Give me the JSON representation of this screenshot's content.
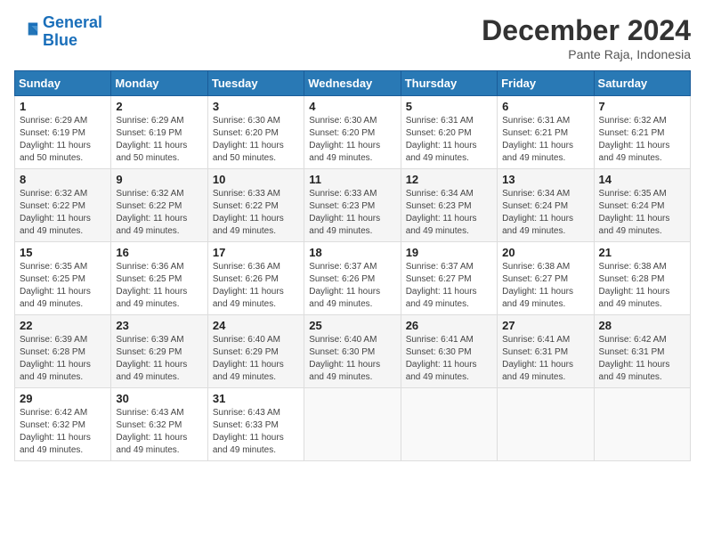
{
  "logo": {
    "line1": "General",
    "line2": "Blue"
  },
  "title": "December 2024",
  "subtitle": "Pante Raja, Indonesia",
  "weekdays": [
    "Sunday",
    "Monday",
    "Tuesday",
    "Wednesday",
    "Thursday",
    "Friday",
    "Saturday"
  ],
  "weeks": [
    [
      {
        "day": 1,
        "sunrise": "6:29 AM",
        "sunset": "6:19 PM",
        "daylight": "11 hours and 50 minutes."
      },
      {
        "day": 2,
        "sunrise": "6:29 AM",
        "sunset": "6:19 PM",
        "daylight": "11 hours and 50 minutes."
      },
      {
        "day": 3,
        "sunrise": "6:30 AM",
        "sunset": "6:20 PM",
        "daylight": "11 hours and 50 minutes."
      },
      {
        "day": 4,
        "sunrise": "6:30 AM",
        "sunset": "6:20 PM",
        "daylight": "11 hours and 49 minutes."
      },
      {
        "day": 5,
        "sunrise": "6:31 AM",
        "sunset": "6:20 PM",
        "daylight": "11 hours and 49 minutes."
      },
      {
        "day": 6,
        "sunrise": "6:31 AM",
        "sunset": "6:21 PM",
        "daylight": "11 hours and 49 minutes."
      },
      {
        "day": 7,
        "sunrise": "6:32 AM",
        "sunset": "6:21 PM",
        "daylight": "11 hours and 49 minutes."
      }
    ],
    [
      {
        "day": 8,
        "sunrise": "6:32 AM",
        "sunset": "6:22 PM",
        "daylight": "11 hours and 49 minutes."
      },
      {
        "day": 9,
        "sunrise": "6:32 AM",
        "sunset": "6:22 PM",
        "daylight": "11 hours and 49 minutes."
      },
      {
        "day": 10,
        "sunrise": "6:33 AM",
        "sunset": "6:22 PM",
        "daylight": "11 hours and 49 minutes."
      },
      {
        "day": 11,
        "sunrise": "6:33 AM",
        "sunset": "6:23 PM",
        "daylight": "11 hours and 49 minutes."
      },
      {
        "day": 12,
        "sunrise": "6:34 AM",
        "sunset": "6:23 PM",
        "daylight": "11 hours and 49 minutes."
      },
      {
        "day": 13,
        "sunrise": "6:34 AM",
        "sunset": "6:24 PM",
        "daylight": "11 hours and 49 minutes."
      },
      {
        "day": 14,
        "sunrise": "6:35 AM",
        "sunset": "6:24 PM",
        "daylight": "11 hours and 49 minutes."
      }
    ],
    [
      {
        "day": 15,
        "sunrise": "6:35 AM",
        "sunset": "6:25 PM",
        "daylight": "11 hours and 49 minutes."
      },
      {
        "day": 16,
        "sunrise": "6:36 AM",
        "sunset": "6:25 PM",
        "daylight": "11 hours and 49 minutes."
      },
      {
        "day": 17,
        "sunrise": "6:36 AM",
        "sunset": "6:26 PM",
        "daylight": "11 hours and 49 minutes."
      },
      {
        "day": 18,
        "sunrise": "6:37 AM",
        "sunset": "6:26 PM",
        "daylight": "11 hours and 49 minutes."
      },
      {
        "day": 19,
        "sunrise": "6:37 AM",
        "sunset": "6:27 PM",
        "daylight": "11 hours and 49 minutes."
      },
      {
        "day": 20,
        "sunrise": "6:38 AM",
        "sunset": "6:27 PM",
        "daylight": "11 hours and 49 minutes."
      },
      {
        "day": 21,
        "sunrise": "6:38 AM",
        "sunset": "6:28 PM",
        "daylight": "11 hours and 49 minutes."
      }
    ],
    [
      {
        "day": 22,
        "sunrise": "6:39 AM",
        "sunset": "6:28 PM",
        "daylight": "11 hours and 49 minutes."
      },
      {
        "day": 23,
        "sunrise": "6:39 AM",
        "sunset": "6:29 PM",
        "daylight": "11 hours and 49 minutes."
      },
      {
        "day": 24,
        "sunrise": "6:40 AM",
        "sunset": "6:29 PM",
        "daylight": "11 hours and 49 minutes."
      },
      {
        "day": 25,
        "sunrise": "6:40 AM",
        "sunset": "6:30 PM",
        "daylight": "11 hours and 49 minutes."
      },
      {
        "day": 26,
        "sunrise": "6:41 AM",
        "sunset": "6:30 PM",
        "daylight": "11 hours and 49 minutes."
      },
      {
        "day": 27,
        "sunrise": "6:41 AM",
        "sunset": "6:31 PM",
        "daylight": "11 hours and 49 minutes."
      },
      {
        "day": 28,
        "sunrise": "6:42 AM",
        "sunset": "6:31 PM",
        "daylight": "11 hours and 49 minutes."
      }
    ],
    [
      {
        "day": 29,
        "sunrise": "6:42 AM",
        "sunset": "6:32 PM",
        "daylight": "11 hours and 49 minutes."
      },
      {
        "day": 30,
        "sunrise": "6:43 AM",
        "sunset": "6:32 PM",
        "daylight": "11 hours and 49 minutes."
      },
      {
        "day": 31,
        "sunrise": "6:43 AM",
        "sunset": "6:33 PM",
        "daylight": "11 hours and 49 minutes."
      },
      null,
      null,
      null,
      null
    ]
  ]
}
